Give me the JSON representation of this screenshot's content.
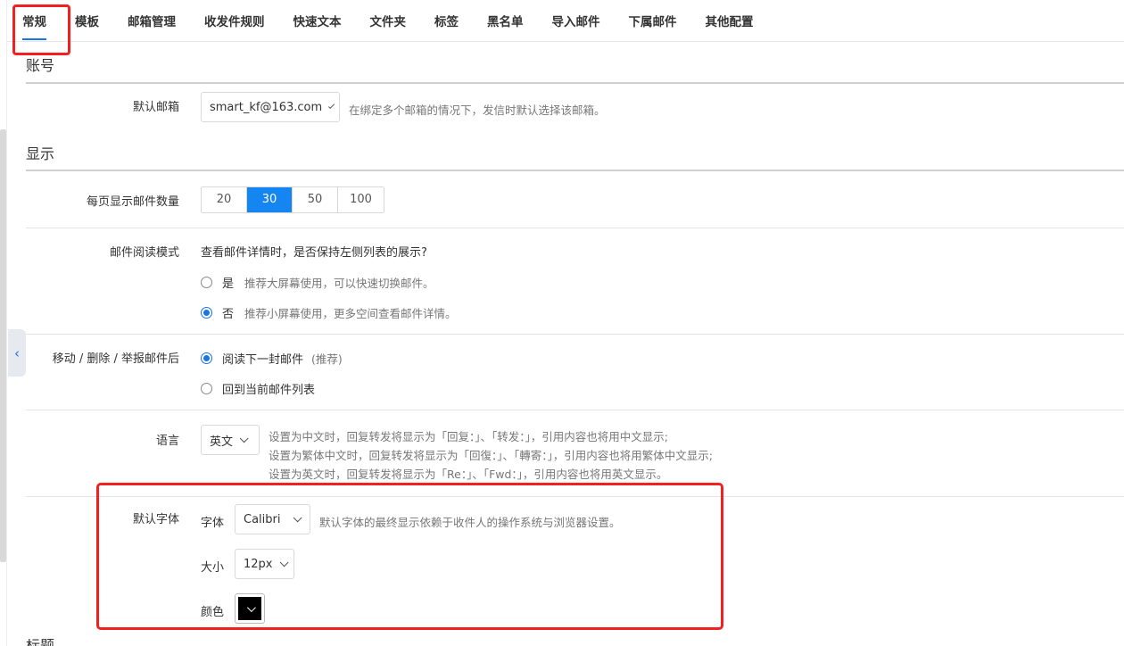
{
  "tabs": [
    {
      "label": "常规",
      "active": true
    },
    {
      "label": "模板"
    },
    {
      "label": "邮箱管理"
    },
    {
      "label": "收发件规则"
    },
    {
      "label": "快速文本"
    },
    {
      "label": "文件夹"
    },
    {
      "label": "标签"
    },
    {
      "label": "黑名单"
    },
    {
      "label": "导入邮件"
    },
    {
      "label": "下属邮件"
    },
    {
      "label": "其他配置"
    }
  ],
  "account": {
    "section_title": "账号",
    "default_mailbox_label": "默认邮箱",
    "default_mailbox_value": "smart_kf@163.com",
    "default_mailbox_hint": "在绑定多个邮箱的情况下，发信时默认选择该邮箱。"
  },
  "display": {
    "section_title": "显示",
    "per_page_label": "每页显示邮件数量",
    "per_page_options": [
      "20",
      "30",
      "50",
      "100"
    ],
    "per_page_selected": "30",
    "read_mode_label": "邮件阅读模式",
    "read_mode_question": "查看邮件详情时，是否保持左侧列表的展示?",
    "read_mode_options": [
      {
        "label": "是",
        "hint": "推荐大屏幕使用，可以快速切换邮件。",
        "checked": false
      },
      {
        "label": "否",
        "hint": "推荐小屏幕使用，更多空间查看邮件详情。",
        "checked": true
      }
    ],
    "after_action_label": "移动 / 删除 / 举报邮件后",
    "after_action_options": [
      {
        "label": "阅读下一封邮件",
        "hint": "(推荐)",
        "checked": true
      },
      {
        "label": "回到当前邮件列表",
        "hint": "",
        "checked": false
      }
    ],
    "language_label": "语言",
    "language_value": "英文",
    "language_hints": [
      "设置为中文时，回复转发将显示为「回复：」、「转发：」，引用内容也将用中文显示;",
      "设置为繁体中文时，回复转发将显示为「回復：」、「轉寄：」，引用内容也将用繁体中文显示;",
      "设置为英文时，回复转发将显示为「Re：」、「Fwd：」，引用内容也将用英文显示。"
    ],
    "default_font_label": "默认字体",
    "font_label": "字体",
    "font_value": "Calibri",
    "font_hint": "默认字体的最终显示依赖于收件人的操作系统与浏览器设置。",
    "size_label": "大小",
    "size_value": "12px",
    "color_label": "颜色",
    "color_value": "#000000"
  },
  "next_section_title": "标题",
  "colors": {
    "accent": "#1585f1",
    "highlight": "#f2201f"
  }
}
